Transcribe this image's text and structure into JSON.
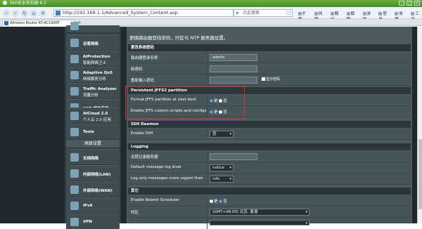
{
  "browser": {
    "title": "360安全浏览器 6.1",
    "address": "http://192.168.1.1/Advanced_System_Content.asp",
    "search_placeholder": "点此搜索",
    "tools": [
      "扩展",
      "网银",
      "翻译",
      "截图",
      "游戏",
      "登录",
      "收藏",
      "工具"
    ],
    "tab_label": "Wireless Router RT-AC1900P"
  },
  "sidebar": {
    "top_items": [
      {
        "t1": "访客网络",
        "t2": "",
        "icon": "guest-network-icon"
      },
      {
        "t1": "AiProtection",
        "t2": "智能网络卫士",
        "icon": "shield-icon"
      },
      {
        "t1": "Adaptive QoS",
        "t2": "网络服务分析",
        "icon": "gauge-icon"
      },
      {
        "t1": "Traffic Analyzer",
        "t2": "流量分析",
        "icon": "chart-icon"
      },
      {
        "t1": "USB 相关应用",
        "t2": "",
        "icon": "usb-icon"
      },
      {
        "t1": "AiCloud 2.0",
        "t2": "个人云 2.0 应用",
        "icon": "cloud-icon"
      },
      {
        "t1": "Tools",
        "t2": "",
        "icon": "wrench-icon"
      }
    ],
    "advanced_header": "高级设置",
    "advanced_items": [
      {
        "t1": "无线网络",
        "icon": "wireless-icon"
      },
      {
        "t1": "内部网络(LAN)",
        "icon": "home-icon"
      },
      {
        "t1": "外部网络(WAN)",
        "icon": "globe-icon"
      },
      {
        "t1": "IPv6",
        "icon": "ipv6-icon"
      },
      {
        "t1": "VPN",
        "icon": "vpn-icon"
      }
    ]
  },
  "content": {
    "description": "更换路由器登陆密码，时区与 NTP 服务器设置。",
    "sec_password": "更改系统密码",
    "lbl_username": "路由器登录名称",
    "val_username": "admin",
    "lbl_newpass": "新密码",
    "lbl_repass": "重新输入密码",
    "chk_showpass": "显示密码",
    "sec_jffs": "Persistent JFFS2 partition",
    "lbl_format_jffs": "Format JFFS partition at next boot",
    "lbl_enable_jffs": "Enable JFFS custom scripts and configs",
    "yes": "是",
    "no": "否",
    "sec_ssh": "SSH Daemon",
    "lbl_enable_ssh": "Enable SSH",
    "val_enable_ssh": "否",
    "sec_logging": "Logging",
    "lbl_log_server": "远程记录服务器",
    "lbl_default_level": "Default message log level",
    "val_default_level": "notice",
    "lbl_urgent_level": "Log only messages more urgent than",
    "val_urgent_level": "info",
    "sec_misc": "其它",
    "lbl_reboot_sched": "Enable Reboot Scheduler",
    "lbl_timezone": "时区",
    "val_timezone": "(GMT+08:00) 北京, 香港"
  }
}
